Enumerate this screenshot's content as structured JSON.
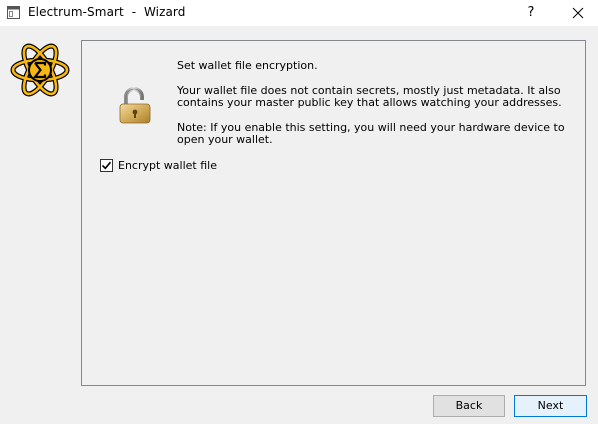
{
  "window": {
    "title": "Electrum-Smart  -  Wizard",
    "help_label": "?",
    "icons": {
      "app": "app-window-icon",
      "close": "close-icon",
      "logo": "electrum-smart-logo-icon",
      "lock": "padlock-icon"
    }
  },
  "content": {
    "heading": "Set wallet file encryption.",
    "body": "Your wallet file does not contain secrets, mostly just metadata. It also contains your master public key that allows watching your addresses.",
    "note": "Note: If you enable this setting, you will need your hardware device to open your wallet.",
    "encrypt_checkbox": {
      "label": "Encrypt wallet file",
      "checked": true
    }
  },
  "buttons": {
    "back": "Back",
    "next": "Next"
  },
  "colors": {
    "logo_yellow": "#f7b80f",
    "accent": "#0078d7"
  }
}
